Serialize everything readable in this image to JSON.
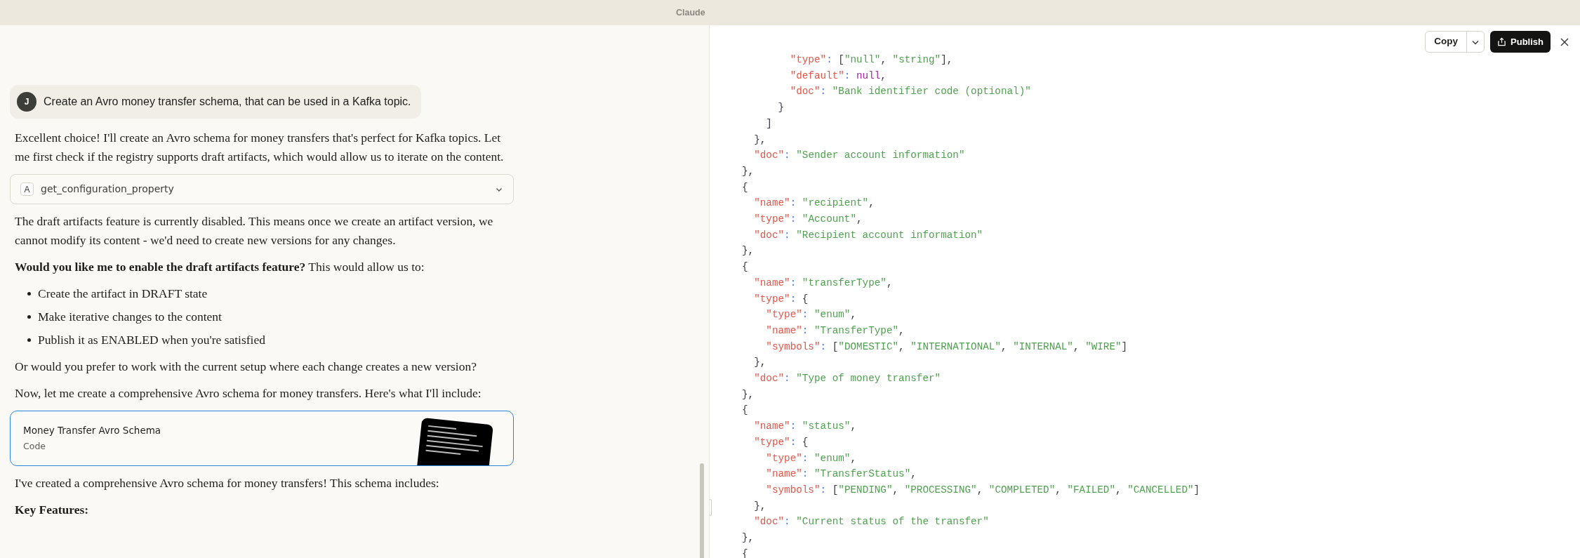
{
  "window": {
    "title": "Claude"
  },
  "chat": {
    "user_message": {
      "avatar": "J",
      "text": "Create an Avro money transfer schema, that can be used in a Kafka topic."
    },
    "blocks": [
      {
        "kind": "paragraph",
        "text": "Excellent choice! I'll create an Avro schema for money transfers that's perfect for Kafka topics. Let me first check if the registry supports draft artifacts, which would allow us to iterate on the content."
      },
      {
        "kind": "tool",
        "badge": "A",
        "text": "get_configuration_property",
        "expanded": false
      },
      {
        "kind": "paragraph",
        "text": "The draft artifacts feature is currently disabled. This means once we create an artifact version, we cannot modify its content - we'd need to create new versions for any changes."
      },
      {
        "kind": "paragraph",
        "text": "**Would you like me to enable the draft artifacts feature?** This would allow us to:"
      },
      {
        "kind": "bullets",
        "items": [
          "Create the artifact in DRAFT state",
          "Make iterative changes to the content",
          "Publish it as ENABLED when you're satisfied"
        ]
      },
      {
        "kind": "paragraph",
        "text": "Or would you prefer to work with the current setup where each change creates a new version?"
      },
      {
        "kind": "paragraph",
        "text": "Now, let me create a comprehensive Avro schema for money transfers. Here's what I'll include:"
      },
      {
        "kind": "artifact",
        "title": "Money Transfer Avro Schema",
        "subtitle": "Code",
        "selected": true
      },
      {
        "kind": "paragraph",
        "text": "I've created a comprehensive Avro schema for money transfers! This schema includes:"
      },
      {
        "kind": "heading",
        "text": "Key Features:"
      }
    ]
  },
  "artifact_panel": {
    "buttons": {
      "copy": "Copy",
      "publish": "Publish"
    },
    "code_lines": [
      [
        {
          "kind": "key",
          "text": "        \"type\""
        },
        {
          "kind": "colon",
          "text": ": "
        },
        {
          "kind": "punct",
          "text": "["
        },
        {
          "kind": "string",
          "text": "\"null\""
        },
        {
          "kind": "punct",
          "text": ", "
        },
        {
          "kind": "string",
          "text": "\"string\""
        },
        {
          "kind": "punct",
          "text": "],"
        }
      ],
      [
        {
          "kind": "key",
          "text": "        \"default\""
        },
        {
          "kind": "colon",
          "text": ": "
        },
        {
          "kind": "null",
          "text": "null"
        },
        {
          "kind": "punct",
          "text": ","
        }
      ],
      [
        {
          "kind": "key",
          "text": "        \"doc\""
        },
        {
          "kind": "colon",
          "text": ": "
        },
        {
          "kind": "string",
          "text": "\"Bank identifier code (optional)\""
        }
      ],
      [
        {
          "kind": "punct",
          "text": "      }"
        }
      ],
      [
        {
          "kind": "punct",
          "text": "    ]"
        }
      ],
      [
        {
          "kind": "punct",
          "text": "  },"
        }
      ],
      [
        {
          "kind": "key",
          "text": "  \"doc\""
        },
        {
          "kind": "colon",
          "text": ": "
        },
        {
          "kind": "string",
          "text": "\"Sender account information\""
        }
      ],
      [
        {
          "kind": "punct",
          "text": "},"
        }
      ],
      [
        {
          "kind": "punct",
          "text": "{"
        }
      ],
      [
        {
          "kind": "key",
          "text": "  \"name\""
        },
        {
          "kind": "colon",
          "text": ": "
        },
        {
          "kind": "string",
          "text": "\"recipient\""
        },
        {
          "kind": "punct",
          "text": ","
        }
      ],
      [
        {
          "kind": "key",
          "text": "  \"type\""
        },
        {
          "kind": "colon",
          "text": ": "
        },
        {
          "kind": "string",
          "text": "\"Account\""
        },
        {
          "kind": "punct",
          "text": ","
        }
      ],
      [
        {
          "kind": "key",
          "text": "  \"doc\""
        },
        {
          "kind": "colon",
          "text": ": "
        },
        {
          "kind": "string",
          "text": "\"Recipient account information\""
        }
      ],
      [
        {
          "kind": "punct",
          "text": "},"
        }
      ],
      [
        {
          "kind": "punct",
          "text": "{"
        }
      ],
      [
        {
          "kind": "key",
          "text": "  \"name\""
        },
        {
          "kind": "colon",
          "text": ": "
        },
        {
          "kind": "string",
          "text": "\"transferType\""
        },
        {
          "kind": "punct",
          "text": ","
        }
      ],
      [
        {
          "kind": "key",
          "text": "  \"type\""
        },
        {
          "kind": "colon",
          "text": ": "
        },
        {
          "kind": "punct",
          "text": "{"
        }
      ],
      [
        {
          "kind": "key",
          "text": "    \"type\""
        },
        {
          "kind": "colon",
          "text": ": "
        },
        {
          "kind": "string",
          "text": "\"enum\""
        },
        {
          "kind": "punct",
          "text": ","
        }
      ],
      [
        {
          "kind": "key",
          "text": "    \"name\""
        },
        {
          "kind": "colon",
          "text": ": "
        },
        {
          "kind": "string",
          "text": "\"TransferType\""
        },
        {
          "kind": "punct",
          "text": ","
        }
      ],
      [
        {
          "kind": "key",
          "text": "    \"symbols\""
        },
        {
          "kind": "colon",
          "text": ": "
        },
        {
          "kind": "punct",
          "text": "["
        },
        {
          "kind": "string",
          "text": "\"DOMESTIC\""
        },
        {
          "kind": "punct",
          "text": ", "
        },
        {
          "kind": "string",
          "text": "\"INTERNATIONAL\""
        },
        {
          "kind": "punct",
          "text": ", "
        },
        {
          "kind": "string",
          "text": "\"INTERNAL\""
        },
        {
          "kind": "punct",
          "text": ", "
        },
        {
          "kind": "string",
          "text": "\"WIRE\""
        },
        {
          "kind": "punct",
          "text": "]"
        }
      ],
      [
        {
          "kind": "punct",
          "text": "  },"
        }
      ],
      [
        {
          "kind": "key",
          "text": "  \"doc\""
        },
        {
          "kind": "colon",
          "text": ": "
        },
        {
          "kind": "string",
          "text": "\"Type of money transfer\""
        }
      ],
      [
        {
          "kind": "punct",
          "text": "},"
        }
      ],
      [
        {
          "kind": "punct",
          "text": "{"
        }
      ],
      [
        {
          "kind": "key",
          "text": "  \"name\""
        },
        {
          "kind": "colon",
          "text": ": "
        },
        {
          "kind": "string",
          "text": "\"status\""
        },
        {
          "kind": "punct",
          "text": ","
        }
      ],
      [
        {
          "kind": "key",
          "text": "  \"type\""
        },
        {
          "kind": "colon",
          "text": ": "
        },
        {
          "kind": "punct",
          "text": "{"
        }
      ],
      [
        {
          "kind": "key",
          "text": "    \"type\""
        },
        {
          "kind": "colon",
          "text": ": "
        },
        {
          "kind": "string",
          "text": "\"enum\""
        },
        {
          "kind": "punct",
          "text": ","
        }
      ],
      [
        {
          "kind": "key",
          "text": "    \"name\""
        },
        {
          "kind": "colon",
          "text": ": "
        },
        {
          "kind": "string",
          "text": "\"TransferStatus\""
        },
        {
          "kind": "punct",
          "text": ","
        }
      ],
      [
        {
          "kind": "key",
          "text": "    \"symbols\""
        },
        {
          "kind": "colon",
          "text": ": "
        },
        {
          "kind": "punct",
          "text": "["
        },
        {
          "kind": "string",
          "text": "\"PENDING\""
        },
        {
          "kind": "punct",
          "text": ", "
        },
        {
          "kind": "string",
          "text": "\"PROCESSING\""
        },
        {
          "kind": "punct",
          "text": ", "
        },
        {
          "kind": "string",
          "text": "\"COMPLETED\""
        },
        {
          "kind": "punct",
          "text": ", "
        },
        {
          "kind": "string",
          "text": "\"FAILED\""
        },
        {
          "kind": "punct",
          "text": ", "
        },
        {
          "kind": "string",
          "text": "\"CANCELLED\""
        },
        {
          "kind": "punct",
          "text": "]"
        }
      ],
      [
        {
          "kind": "punct",
          "text": "  },"
        }
      ],
      [
        {
          "kind": "key",
          "text": "  \"doc\""
        },
        {
          "kind": "colon",
          "text": ": "
        },
        {
          "kind": "string",
          "text": "\"Current status of the transfer\""
        }
      ],
      [
        {
          "kind": "punct",
          "text": "},"
        }
      ],
      [
        {
          "kind": "punct",
          "text": "{"
        }
      ]
    ]
  }
}
